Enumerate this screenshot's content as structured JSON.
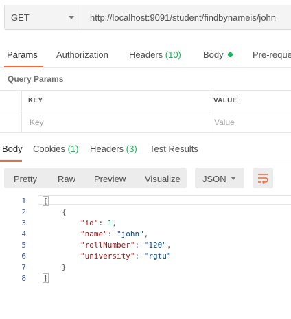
{
  "request": {
    "method": "GET",
    "url": "http://localhost:9091/student/findbynameis/john"
  },
  "request_tabs": [
    {
      "label": "Params"
    },
    {
      "label": "Authorization"
    },
    {
      "label": "Headers",
      "count": "(10)"
    },
    {
      "label": "Body"
    },
    {
      "label": "Pre-reque"
    }
  ],
  "query_params": {
    "title": "Query Params",
    "key_header": "KEY",
    "value_header": "VALUE",
    "key_placeholder": "Key",
    "value_placeholder": "Value"
  },
  "response_tabs": [
    {
      "label": "Body"
    },
    {
      "label": "Cookies",
      "count": "(1)"
    },
    {
      "label": "Headers",
      "count": "(3)"
    },
    {
      "label": "Test Results"
    }
  ],
  "format_toolbar": {
    "modes": [
      "Pretty",
      "Raw",
      "Preview",
      "Visualize"
    ],
    "language": "JSON"
  },
  "response_body": {
    "line_numbers": [
      "1",
      "2",
      "3",
      "4",
      "5",
      "6",
      "7",
      "8"
    ],
    "open_bracket": "[",
    "open_brace": "{",
    "fields": [
      {
        "key": "\"id\"",
        "value": "1",
        "suffix": ","
      },
      {
        "key": "\"name\"",
        "value": "\"john\"",
        "suffix": ","
      },
      {
        "key": "\"rollNumber\"",
        "value": "\"120\"",
        "suffix": ","
      },
      {
        "key": "\"university\"",
        "value": "\"rgtu\"",
        "suffix": ""
      }
    ],
    "close_brace": "}",
    "close_bracket": "]"
  },
  "colors": {
    "accent": "#f26b3a",
    "count_green": "#0cbb52",
    "json_key": "#a31515",
    "json_string": "#0451a5",
    "json_number": "#098658"
  }
}
